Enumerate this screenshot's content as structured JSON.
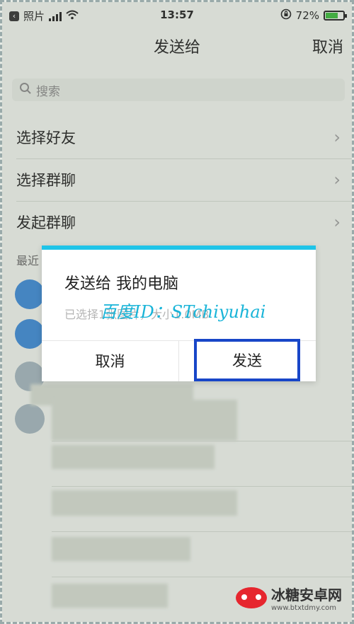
{
  "status_bar": {
    "back_app": "照片",
    "time": "13:57",
    "battery": "72%",
    "battery_level": 0.72
  },
  "nav": {
    "title": "发送给",
    "cancel": "取消"
  },
  "search": {
    "placeholder": "搜索"
  },
  "list": {
    "items": [
      {
        "label": "选择好友"
      },
      {
        "label": "选择群聊"
      },
      {
        "label": "发起群聊"
      }
    ],
    "section_title": "最近"
  },
  "dialog": {
    "title": "发送给 我的电脑",
    "subtitle": "已选择1张图片，大小1.0MB",
    "watermark": "百度ID：STchiyuhai",
    "cancel": "取消",
    "send": "发送"
  },
  "logo": {
    "name": "冰糖安卓网",
    "url": "www.btxtdmy.com"
  },
  "colors": {
    "accent": "#1fc4e8",
    "highlight": "#1846c8",
    "avatar": "#3d86cf"
  }
}
